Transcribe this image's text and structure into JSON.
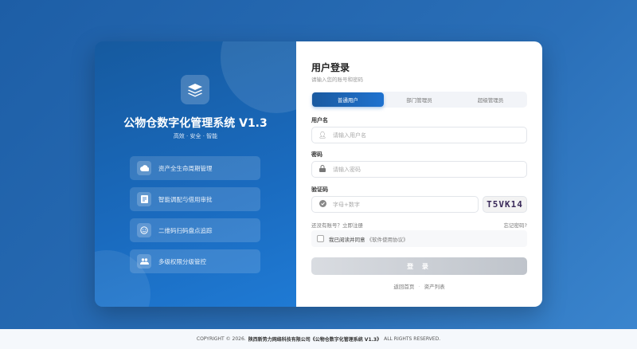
{
  "brand": {
    "title": "公物仓数字化管理系统 V1.3",
    "subtitle": "高效 · 安全 · 智能"
  },
  "features": [
    {
      "label": "资产全生命周期管理",
      "icon": "cloud-icon"
    },
    {
      "label": "智能调配与借用审批",
      "icon": "document-icon"
    },
    {
      "label": "二维码扫码盘点追踪",
      "icon": "smile-icon"
    },
    {
      "label": "多级权限分级管控",
      "icon": "users-icon"
    }
  ],
  "login": {
    "title": "用户登录",
    "subtitle": "请输入您的账号和密码",
    "tabs": [
      "普通用户",
      "部门管理员",
      "超级管理员"
    ],
    "username_label": "用户名",
    "username_placeholder": "请输入用户名",
    "password_label": "密码",
    "password_placeholder": "请输入密码",
    "captcha_label": "验证码",
    "captcha_placeholder": "字母+数字",
    "captcha_code": "T5VK14",
    "register": "还没有账号？立即注册",
    "forgot": "忘记密码?",
    "agree": "我已阅读并同意",
    "agreement": "《软件使用协议》",
    "submit": "登 录",
    "home": "返回首页",
    "sep": "·",
    "assets": "资产列表"
  },
  "footer": {
    "prefix": "COPYRIGHT © 2026.",
    "company": "陕西新势力网络科技有限公司《公物仓数字化管理系统 V1.3》",
    "suffix": "ALL RIGHTS RESERVED."
  }
}
